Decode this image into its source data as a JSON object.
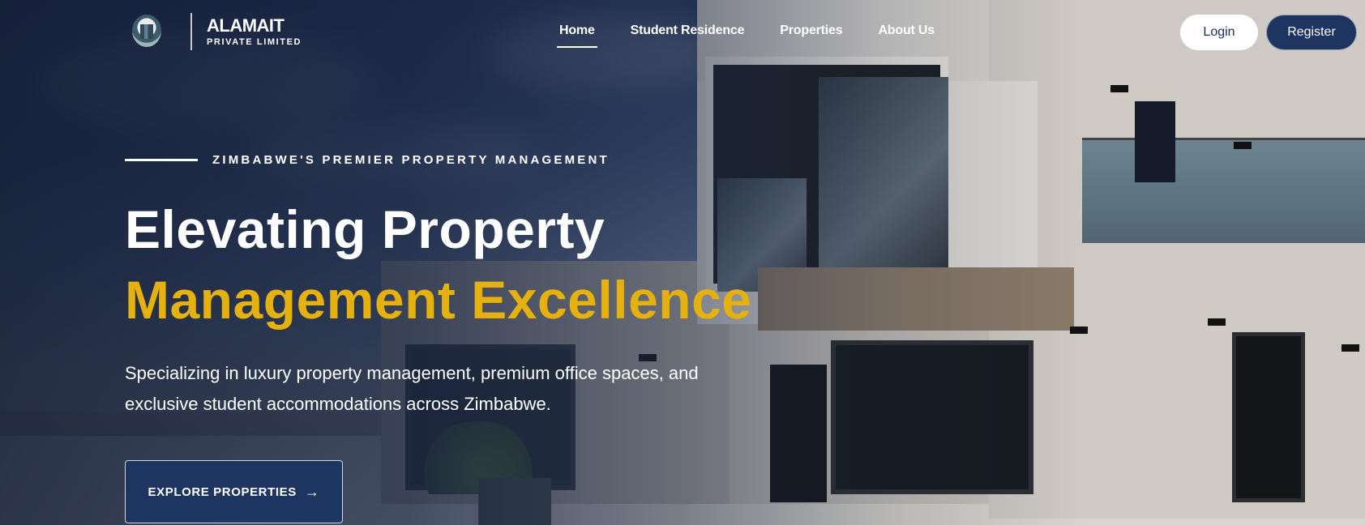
{
  "brand": {
    "name": "ALAMAIT",
    "subtitle": "PRIVATE LIMITED"
  },
  "nav": {
    "items": [
      {
        "label": "Home",
        "active": true
      },
      {
        "label": "Student Residence",
        "active": false
      },
      {
        "label": "Properties",
        "active": false
      },
      {
        "label": "About Us",
        "active": false
      }
    ]
  },
  "auth": {
    "login_label": "Login",
    "register_label": "Register"
  },
  "hero": {
    "eyebrow": "ZIMBABWE'S PREMIER PROPERTY MANAGEMENT",
    "title_line1": "Elevating Property",
    "title_line2": "Management Excellence",
    "description": "Specializing in luxury property management, premium office spaces, and exclusive student accommodations across Zimbabwe.",
    "cta_label": "EXPLORE PROPERTIES",
    "cta_icon": "arrow-right-icon"
  },
  "colors": {
    "accent_gold": "#e5b10e",
    "navy": "#1e3461",
    "white": "#ffffff"
  }
}
